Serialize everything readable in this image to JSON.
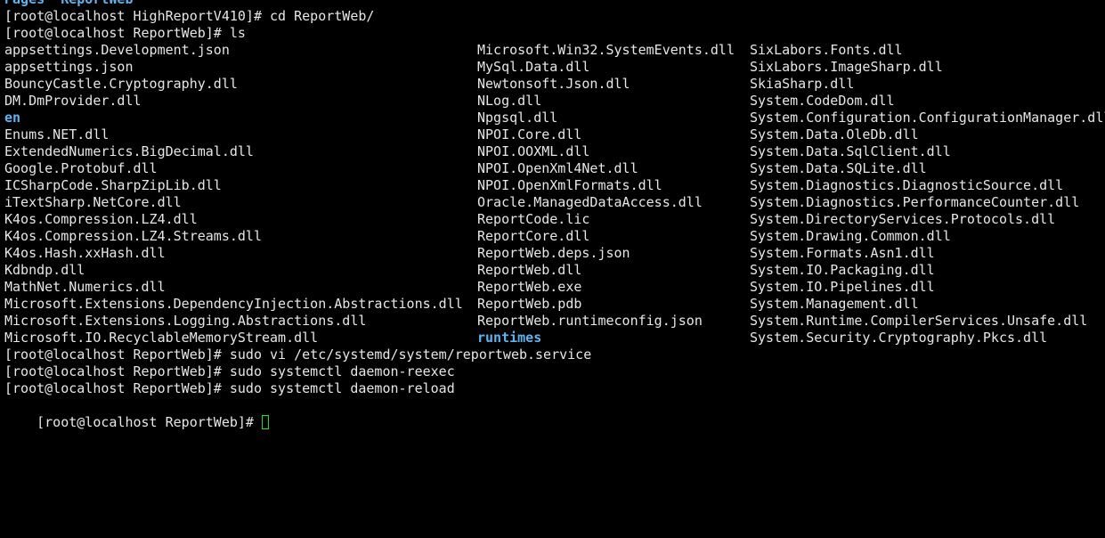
{
  "colors": {
    "background": "#000000",
    "text": "#e6e6e6",
    "directory": "#5fb4f0",
    "cursor": "#22dd22"
  },
  "partial_top_line": "Pages  ReportWeb",
  "lines": [
    "[root@localhost HighReportV410]# cd ReportWeb/",
    "[root@localhost ReportWeb]# ls"
  ],
  "listing": {
    "col1": [
      {
        "text": "appsettings.Development.json",
        "dir": false
      },
      {
        "text": "appsettings.json",
        "dir": false
      },
      {
        "text": "BouncyCastle.Cryptography.dll",
        "dir": false
      },
      {
        "text": "DM.DmProvider.dll",
        "dir": false
      },
      {
        "text": "en",
        "dir": true
      },
      {
        "text": "Enums.NET.dll",
        "dir": false
      },
      {
        "text": "ExtendedNumerics.BigDecimal.dll",
        "dir": false
      },
      {
        "text": "Google.Protobuf.dll",
        "dir": false
      },
      {
        "text": "ICSharpCode.SharpZipLib.dll",
        "dir": false
      },
      {
        "text": "iTextSharp.NetCore.dll",
        "dir": false
      },
      {
        "text": "K4os.Compression.LZ4.dll",
        "dir": false
      },
      {
        "text": "K4os.Compression.LZ4.Streams.dll",
        "dir": false
      },
      {
        "text": "K4os.Hash.xxHash.dll",
        "dir": false
      },
      {
        "text": "Kdbndp.dll",
        "dir": false
      },
      {
        "text": "MathNet.Numerics.dll",
        "dir": false
      },
      {
        "text": "Microsoft.Extensions.DependencyInjection.Abstractions.dll",
        "dir": false
      },
      {
        "text": "Microsoft.Extensions.Logging.Abstractions.dll",
        "dir": false
      },
      {
        "text": "Microsoft.IO.RecyclableMemoryStream.dll",
        "dir": false
      }
    ],
    "col2": [
      {
        "text": "Microsoft.Win32.SystemEvents.dll",
        "dir": false
      },
      {
        "text": "MySql.Data.dll",
        "dir": false
      },
      {
        "text": "Newtonsoft.Json.dll",
        "dir": false
      },
      {
        "text": "NLog.dll",
        "dir": false
      },
      {
        "text": "Npgsql.dll",
        "dir": false
      },
      {
        "text": "NPOI.Core.dll",
        "dir": false
      },
      {
        "text": "NPOI.OOXML.dll",
        "dir": false
      },
      {
        "text": "NPOI.OpenXml4Net.dll",
        "dir": false
      },
      {
        "text": "NPOI.OpenXmlFormats.dll",
        "dir": false
      },
      {
        "text": "Oracle.ManagedDataAccess.dll",
        "dir": false
      },
      {
        "text": "ReportCode.lic",
        "dir": false
      },
      {
        "text": "ReportCore.dll",
        "dir": false
      },
      {
        "text": "ReportWeb.deps.json",
        "dir": false
      },
      {
        "text": "ReportWeb.dll",
        "dir": false
      },
      {
        "text": "ReportWeb.exe",
        "dir": false
      },
      {
        "text": "ReportWeb.pdb",
        "dir": false
      },
      {
        "text": "ReportWeb.runtimeconfig.json",
        "dir": false
      },
      {
        "text": "runtimes",
        "dir": true
      }
    ],
    "col3": [
      {
        "text": "SixLabors.Fonts.dll",
        "dir": false
      },
      {
        "text": "SixLabors.ImageSharp.dll",
        "dir": false
      },
      {
        "text": "SkiaSharp.dll",
        "dir": false
      },
      {
        "text": "System.CodeDom.dll",
        "dir": false
      },
      {
        "text": "System.Configuration.ConfigurationManager.dll",
        "dir": false
      },
      {
        "text": "System.Data.OleDb.dll",
        "dir": false
      },
      {
        "text": "System.Data.SqlClient.dll",
        "dir": false
      },
      {
        "text": "System.Data.SQLite.dll",
        "dir": false
      },
      {
        "text": "System.Diagnostics.DiagnosticSource.dll",
        "dir": false
      },
      {
        "text": "System.Diagnostics.PerformanceCounter.dll",
        "dir": false
      },
      {
        "text": "System.DirectoryServices.Protocols.dll",
        "dir": false
      },
      {
        "text": "System.Drawing.Common.dll",
        "dir": false
      },
      {
        "text": "System.Formats.Asn1.dll",
        "dir": false
      },
      {
        "text": "System.IO.Packaging.dll",
        "dir": false
      },
      {
        "text": "System.IO.Pipelines.dll",
        "dir": false
      },
      {
        "text": "System.Management.dll",
        "dir": false
      },
      {
        "text": "System.Runtime.CompilerServices.Unsafe.dll",
        "dir": false
      },
      {
        "text": "System.Security.Cryptography.Pkcs.dll",
        "dir": false
      }
    ]
  },
  "after_lines": [
    "[root@localhost ReportWeb]# sudo vi /etc/systemd/system/reportweb.service",
    "[root@localhost ReportWeb]# sudo systemctl daemon-reexec",
    "[root@localhost ReportWeb]# sudo systemctl daemon-reload"
  ],
  "prompt": "[root@localhost ReportWeb]# "
}
